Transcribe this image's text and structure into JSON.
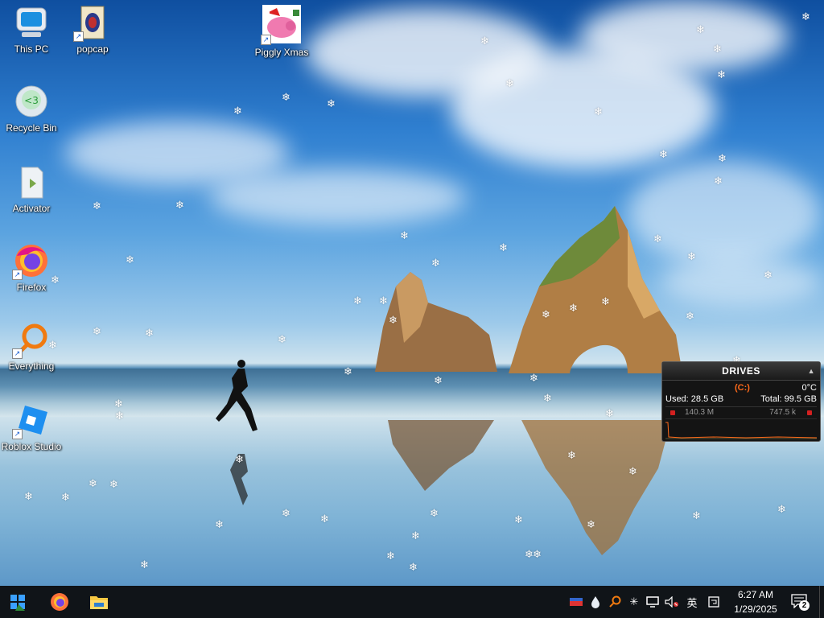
{
  "desktop": {
    "icons": [
      {
        "label": "This PC",
        "icon": "computer-icon"
      },
      {
        "label": "popcap",
        "icon": "popcap-game-icon"
      },
      {
        "label": "Piggly Xmas",
        "icon": "pig-icon"
      },
      {
        "label": "Recycle Bin",
        "icon": "recycle-bin-icon"
      },
      {
        "label": "Activator",
        "icon": "file-icon"
      },
      {
        "label": "Firefox",
        "icon": "firefox-icon"
      },
      {
        "label": "Everything",
        "icon": "search-icon"
      },
      {
        "label": "Roblox Studio",
        "icon": "roblox-studio-icon"
      }
    ],
    "snowflake_glyph": "❄"
  },
  "drives_gadget": {
    "title": "DRIVES",
    "drive": "(C:)",
    "temperature": "0°C",
    "used": "Used: 28.5 GB",
    "total": "Total: 99.5 GB",
    "read_rate": "140.3 M",
    "write_rate": "747.5 k",
    "accent_color": "#ff6a1a"
  },
  "taskbar": {
    "start": "start-icon",
    "pinned": [
      "firefox-icon",
      "file-explorer-icon"
    ],
    "tray": {
      "ime": "英",
      "icons": [
        "security-icon",
        "water-drop-icon",
        "search-icon",
        "snowflake-icon",
        "network-icon",
        "volume-muted-icon",
        "ime-icon",
        "clipboard-icon"
      ]
    },
    "clock": {
      "time": "6:27 AM",
      "date": "1/29/2025"
    },
    "notifications": {
      "count": "2"
    }
  }
}
